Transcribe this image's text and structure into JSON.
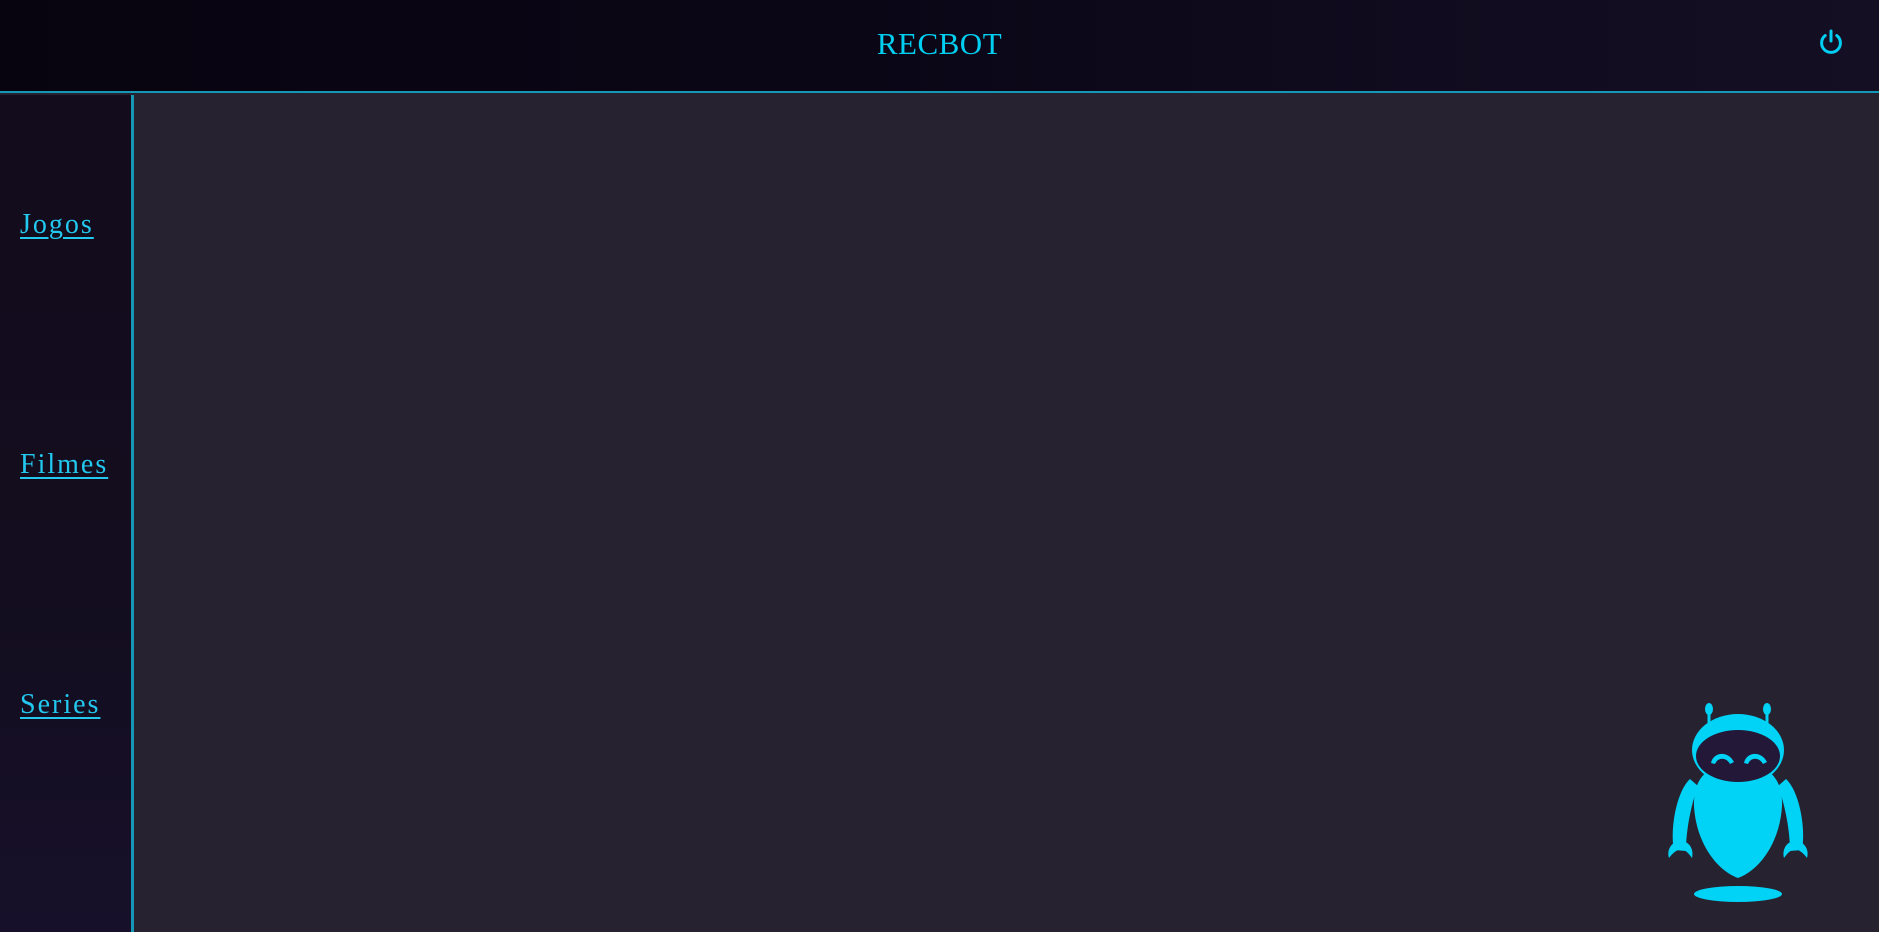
{
  "header": {
    "title": "RECBOT",
    "power_icon": "power-icon"
  },
  "sidebar": {
    "items": [
      {
        "label": "Jogos"
      },
      {
        "label": "Filmes"
      },
      {
        "label": "Series"
      }
    ]
  },
  "assistant": {
    "icon": "robot-icon"
  },
  "colors": {
    "accent": "#00cff2",
    "border": "#1597b8",
    "header_bg": "#08040f",
    "sidebar_bg": "#130d1f",
    "main_bg": "#262230",
    "robot_visor": "#231838"
  }
}
